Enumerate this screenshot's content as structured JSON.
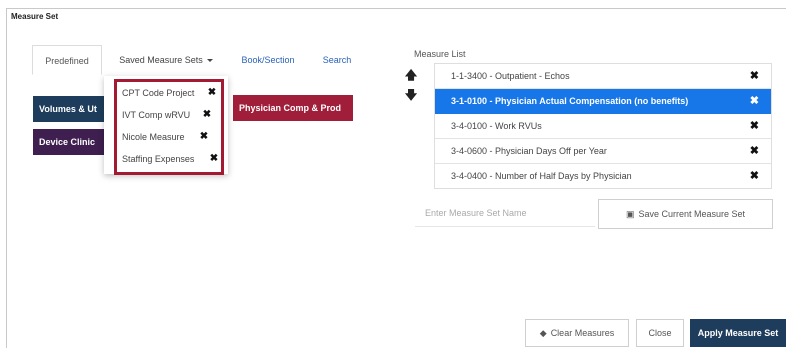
{
  "panel": {
    "title": "Measure Set"
  },
  "tabs": {
    "predefined": "Predefined",
    "saved_measure_sets": "Saved Measure Sets",
    "book_section": "Book/Section",
    "search": "Search"
  },
  "chips": {
    "volumes": "Volumes & Ut",
    "device_clinic": "Device Clinic",
    "physician_comp": "Physician Comp & Prod"
  },
  "saved_sets": [
    {
      "label": "CPT Code Project"
    },
    {
      "label": "IVT Comp wRVU"
    },
    {
      "label": "Nicole Measure"
    },
    {
      "label": "Staffing Expenses"
    }
  ],
  "measure_list": {
    "label": "Measure List",
    "items": [
      {
        "label": "1-1-3400 - Outpatient - Echos",
        "selected": false
      },
      {
        "label": "3-1-0100 - Physician Actual Compensation (no benefits)",
        "selected": true
      },
      {
        "label": "3-4-0100 - Work RVUs",
        "selected": false
      },
      {
        "label": "3-4-0600 - Physician Days Off per Year",
        "selected": false
      },
      {
        "label": "3-4-0400 - Number of Half Days by Physician",
        "selected": false
      }
    ]
  },
  "set_name": {
    "placeholder": "Enter Measure Set Name",
    "value": ""
  },
  "buttons": {
    "save_current": "Save Current Measure Set",
    "clear": "Clear Measures",
    "close": "Close",
    "apply": "Apply Measure Set"
  },
  "icons": {
    "remove": "close-icon",
    "up": "arrow-up-icon",
    "down": "arrow-down-icon",
    "save": "floppy-disk-icon",
    "eraser": "eraser-icon"
  },
  "colors": {
    "navy": "#1e3d5c",
    "purple": "#3e1f4f",
    "crimson": "#a11e3a",
    "selected_blue": "#1877e8",
    "link_blue": "#2a62b8"
  }
}
